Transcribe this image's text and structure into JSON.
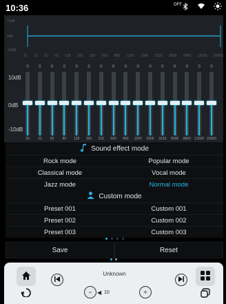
{
  "status": {
    "time": "10:36",
    "off_label": "OFF",
    "icons": [
      "bluetooth-off-icon",
      "wifi-icon",
      "brightness-icon"
    ]
  },
  "curve": {
    "labels": [
      "10dB",
      "0dB",
      "-10dB"
    ],
    "frequencies": [
      "20",
      "31",
      "50",
      "80",
      "125",
      "200",
      "315",
      "500",
      "800",
      "1250",
      "2000",
      "3150",
      "5000",
      "8000",
      "12500",
      "20000"
    ]
  },
  "equalizer": {
    "axis": [
      "10dB",
      "0dB",
      "-10dB"
    ],
    "gains": [
      "0",
      "0",
      "0",
      "0",
      "0",
      "0",
      "0",
      "0",
      "0",
      "0",
      "0",
      "0",
      "0",
      "0",
      "0",
      "0"
    ],
    "frequencies": [
      "20",
      "31",
      "50",
      "80",
      "125",
      "200",
      "315",
      "500",
      "800",
      "1250",
      "2000",
      "3150",
      "5000",
      "8000",
      "12500",
      "20000"
    ]
  },
  "sound_effect": {
    "title": "Sound effect mode",
    "icon": "music-note-icon",
    "modes": [
      "Rock mode",
      "Popular mode",
      "Classical mode",
      "Vocal mode",
      "Jazz mode",
      "Normal mode"
    ],
    "active": "Normal mode"
  },
  "custom": {
    "title": "Custom mode",
    "icon": "person-icon",
    "presets": [
      "Preset 001",
      "Custom 001",
      "Preset 002",
      "Custom 002",
      "Preset 003",
      "Custom 003"
    ]
  },
  "actions": {
    "save": "Save",
    "reset": "Reset"
  },
  "player": {
    "track": "Unknown",
    "volume": "10",
    "accent": "#29b3e6"
  }
}
